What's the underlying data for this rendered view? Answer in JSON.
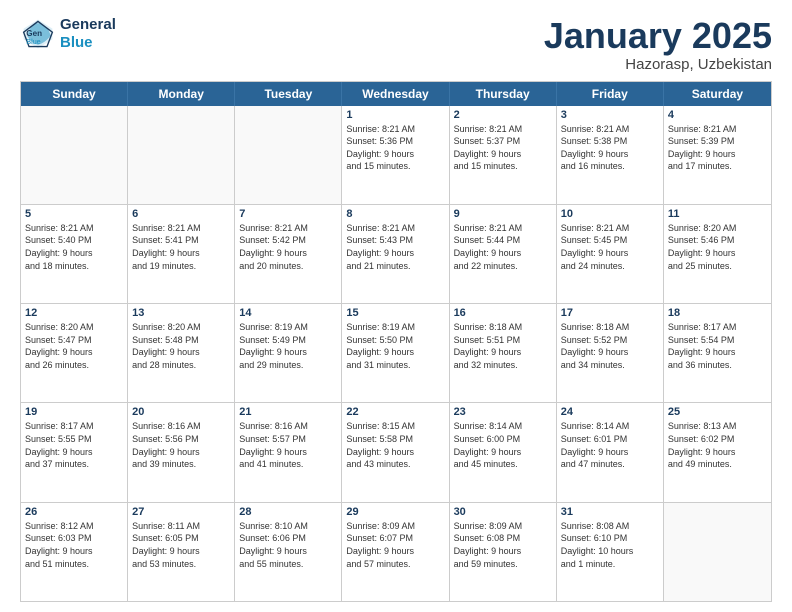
{
  "header": {
    "logo_line1": "General",
    "logo_line2": "Blue",
    "title": "January 2025",
    "subtitle": "Hazorasp, Uzbekistan"
  },
  "days_of_week": [
    "Sunday",
    "Monday",
    "Tuesday",
    "Wednesday",
    "Thursday",
    "Friday",
    "Saturday"
  ],
  "weeks": [
    [
      {
        "day": "",
        "info": ""
      },
      {
        "day": "",
        "info": ""
      },
      {
        "day": "",
        "info": ""
      },
      {
        "day": "1",
        "info": "Sunrise: 8:21 AM\nSunset: 5:36 PM\nDaylight: 9 hours\nand 15 minutes."
      },
      {
        "day": "2",
        "info": "Sunrise: 8:21 AM\nSunset: 5:37 PM\nDaylight: 9 hours\nand 15 minutes."
      },
      {
        "day": "3",
        "info": "Sunrise: 8:21 AM\nSunset: 5:38 PM\nDaylight: 9 hours\nand 16 minutes."
      },
      {
        "day": "4",
        "info": "Sunrise: 8:21 AM\nSunset: 5:39 PM\nDaylight: 9 hours\nand 17 minutes."
      }
    ],
    [
      {
        "day": "5",
        "info": "Sunrise: 8:21 AM\nSunset: 5:40 PM\nDaylight: 9 hours\nand 18 minutes."
      },
      {
        "day": "6",
        "info": "Sunrise: 8:21 AM\nSunset: 5:41 PM\nDaylight: 9 hours\nand 19 minutes."
      },
      {
        "day": "7",
        "info": "Sunrise: 8:21 AM\nSunset: 5:42 PM\nDaylight: 9 hours\nand 20 minutes."
      },
      {
        "day": "8",
        "info": "Sunrise: 8:21 AM\nSunset: 5:43 PM\nDaylight: 9 hours\nand 21 minutes."
      },
      {
        "day": "9",
        "info": "Sunrise: 8:21 AM\nSunset: 5:44 PM\nDaylight: 9 hours\nand 22 minutes."
      },
      {
        "day": "10",
        "info": "Sunrise: 8:21 AM\nSunset: 5:45 PM\nDaylight: 9 hours\nand 24 minutes."
      },
      {
        "day": "11",
        "info": "Sunrise: 8:20 AM\nSunset: 5:46 PM\nDaylight: 9 hours\nand 25 minutes."
      }
    ],
    [
      {
        "day": "12",
        "info": "Sunrise: 8:20 AM\nSunset: 5:47 PM\nDaylight: 9 hours\nand 26 minutes."
      },
      {
        "day": "13",
        "info": "Sunrise: 8:20 AM\nSunset: 5:48 PM\nDaylight: 9 hours\nand 28 minutes."
      },
      {
        "day": "14",
        "info": "Sunrise: 8:19 AM\nSunset: 5:49 PM\nDaylight: 9 hours\nand 29 minutes."
      },
      {
        "day": "15",
        "info": "Sunrise: 8:19 AM\nSunset: 5:50 PM\nDaylight: 9 hours\nand 31 minutes."
      },
      {
        "day": "16",
        "info": "Sunrise: 8:18 AM\nSunset: 5:51 PM\nDaylight: 9 hours\nand 32 minutes."
      },
      {
        "day": "17",
        "info": "Sunrise: 8:18 AM\nSunset: 5:52 PM\nDaylight: 9 hours\nand 34 minutes."
      },
      {
        "day": "18",
        "info": "Sunrise: 8:17 AM\nSunset: 5:54 PM\nDaylight: 9 hours\nand 36 minutes."
      }
    ],
    [
      {
        "day": "19",
        "info": "Sunrise: 8:17 AM\nSunset: 5:55 PM\nDaylight: 9 hours\nand 37 minutes."
      },
      {
        "day": "20",
        "info": "Sunrise: 8:16 AM\nSunset: 5:56 PM\nDaylight: 9 hours\nand 39 minutes."
      },
      {
        "day": "21",
        "info": "Sunrise: 8:16 AM\nSunset: 5:57 PM\nDaylight: 9 hours\nand 41 minutes."
      },
      {
        "day": "22",
        "info": "Sunrise: 8:15 AM\nSunset: 5:58 PM\nDaylight: 9 hours\nand 43 minutes."
      },
      {
        "day": "23",
        "info": "Sunrise: 8:14 AM\nSunset: 6:00 PM\nDaylight: 9 hours\nand 45 minutes."
      },
      {
        "day": "24",
        "info": "Sunrise: 8:14 AM\nSunset: 6:01 PM\nDaylight: 9 hours\nand 47 minutes."
      },
      {
        "day": "25",
        "info": "Sunrise: 8:13 AM\nSunset: 6:02 PM\nDaylight: 9 hours\nand 49 minutes."
      }
    ],
    [
      {
        "day": "26",
        "info": "Sunrise: 8:12 AM\nSunset: 6:03 PM\nDaylight: 9 hours\nand 51 minutes."
      },
      {
        "day": "27",
        "info": "Sunrise: 8:11 AM\nSunset: 6:05 PM\nDaylight: 9 hours\nand 53 minutes."
      },
      {
        "day": "28",
        "info": "Sunrise: 8:10 AM\nSunset: 6:06 PM\nDaylight: 9 hours\nand 55 minutes."
      },
      {
        "day": "29",
        "info": "Sunrise: 8:09 AM\nSunset: 6:07 PM\nDaylight: 9 hours\nand 57 minutes."
      },
      {
        "day": "30",
        "info": "Sunrise: 8:09 AM\nSunset: 6:08 PM\nDaylight: 9 hours\nand 59 minutes."
      },
      {
        "day": "31",
        "info": "Sunrise: 8:08 AM\nSunset: 6:10 PM\nDaylight: 10 hours\nand 1 minute."
      },
      {
        "day": "",
        "info": ""
      }
    ]
  ]
}
